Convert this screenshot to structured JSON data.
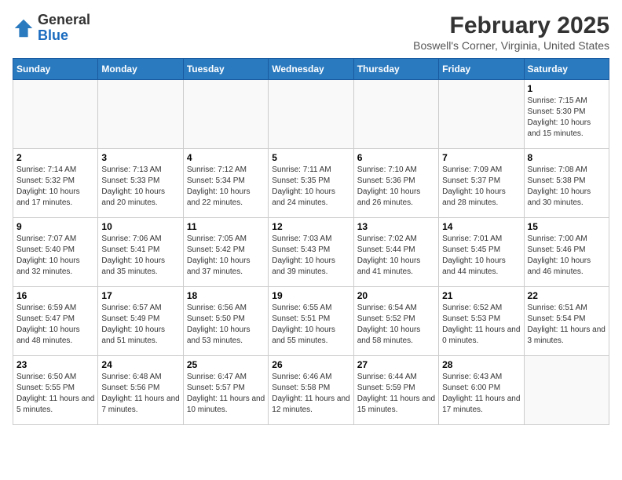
{
  "header": {
    "logo_general": "General",
    "logo_blue": "Blue",
    "month": "February 2025",
    "location": "Boswell's Corner, Virginia, United States"
  },
  "days_of_week": [
    "Sunday",
    "Monday",
    "Tuesday",
    "Wednesday",
    "Thursday",
    "Friday",
    "Saturday"
  ],
  "weeks": [
    [
      {
        "day": "",
        "info": ""
      },
      {
        "day": "",
        "info": ""
      },
      {
        "day": "",
        "info": ""
      },
      {
        "day": "",
        "info": ""
      },
      {
        "day": "",
        "info": ""
      },
      {
        "day": "",
        "info": ""
      },
      {
        "day": "1",
        "info": "Sunrise: 7:15 AM\nSunset: 5:30 PM\nDaylight: 10 hours\nand 15 minutes."
      }
    ],
    [
      {
        "day": "2",
        "info": "Sunrise: 7:14 AM\nSunset: 5:32 PM\nDaylight: 10 hours\nand 17 minutes."
      },
      {
        "day": "3",
        "info": "Sunrise: 7:13 AM\nSunset: 5:33 PM\nDaylight: 10 hours\nand 20 minutes."
      },
      {
        "day": "4",
        "info": "Sunrise: 7:12 AM\nSunset: 5:34 PM\nDaylight: 10 hours\nand 22 minutes."
      },
      {
        "day": "5",
        "info": "Sunrise: 7:11 AM\nSunset: 5:35 PM\nDaylight: 10 hours\nand 24 minutes."
      },
      {
        "day": "6",
        "info": "Sunrise: 7:10 AM\nSunset: 5:36 PM\nDaylight: 10 hours\nand 26 minutes."
      },
      {
        "day": "7",
        "info": "Sunrise: 7:09 AM\nSunset: 5:37 PM\nDaylight: 10 hours\nand 28 minutes."
      },
      {
        "day": "8",
        "info": "Sunrise: 7:08 AM\nSunset: 5:38 PM\nDaylight: 10 hours\nand 30 minutes."
      }
    ],
    [
      {
        "day": "9",
        "info": "Sunrise: 7:07 AM\nSunset: 5:40 PM\nDaylight: 10 hours\nand 32 minutes."
      },
      {
        "day": "10",
        "info": "Sunrise: 7:06 AM\nSunset: 5:41 PM\nDaylight: 10 hours\nand 35 minutes."
      },
      {
        "day": "11",
        "info": "Sunrise: 7:05 AM\nSunset: 5:42 PM\nDaylight: 10 hours\nand 37 minutes."
      },
      {
        "day": "12",
        "info": "Sunrise: 7:03 AM\nSunset: 5:43 PM\nDaylight: 10 hours\nand 39 minutes."
      },
      {
        "day": "13",
        "info": "Sunrise: 7:02 AM\nSunset: 5:44 PM\nDaylight: 10 hours\nand 41 minutes."
      },
      {
        "day": "14",
        "info": "Sunrise: 7:01 AM\nSunset: 5:45 PM\nDaylight: 10 hours\nand 44 minutes."
      },
      {
        "day": "15",
        "info": "Sunrise: 7:00 AM\nSunset: 5:46 PM\nDaylight: 10 hours\nand 46 minutes."
      }
    ],
    [
      {
        "day": "16",
        "info": "Sunrise: 6:59 AM\nSunset: 5:47 PM\nDaylight: 10 hours\nand 48 minutes."
      },
      {
        "day": "17",
        "info": "Sunrise: 6:57 AM\nSunset: 5:49 PM\nDaylight: 10 hours\nand 51 minutes."
      },
      {
        "day": "18",
        "info": "Sunrise: 6:56 AM\nSunset: 5:50 PM\nDaylight: 10 hours\nand 53 minutes."
      },
      {
        "day": "19",
        "info": "Sunrise: 6:55 AM\nSunset: 5:51 PM\nDaylight: 10 hours\nand 55 minutes."
      },
      {
        "day": "20",
        "info": "Sunrise: 6:54 AM\nSunset: 5:52 PM\nDaylight: 10 hours\nand 58 minutes."
      },
      {
        "day": "21",
        "info": "Sunrise: 6:52 AM\nSunset: 5:53 PM\nDaylight: 11 hours\nand 0 minutes."
      },
      {
        "day": "22",
        "info": "Sunrise: 6:51 AM\nSunset: 5:54 PM\nDaylight: 11 hours\nand 3 minutes."
      }
    ],
    [
      {
        "day": "23",
        "info": "Sunrise: 6:50 AM\nSunset: 5:55 PM\nDaylight: 11 hours\nand 5 minutes."
      },
      {
        "day": "24",
        "info": "Sunrise: 6:48 AM\nSunset: 5:56 PM\nDaylight: 11 hours\nand 7 minutes."
      },
      {
        "day": "25",
        "info": "Sunrise: 6:47 AM\nSunset: 5:57 PM\nDaylight: 11 hours\nand 10 minutes."
      },
      {
        "day": "26",
        "info": "Sunrise: 6:46 AM\nSunset: 5:58 PM\nDaylight: 11 hours\nand 12 minutes."
      },
      {
        "day": "27",
        "info": "Sunrise: 6:44 AM\nSunset: 5:59 PM\nDaylight: 11 hours\nand 15 minutes."
      },
      {
        "day": "28",
        "info": "Sunrise: 6:43 AM\nSunset: 6:00 PM\nDaylight: 11 hours\nand 17 minutes."
      },
      {
        "day": "",
        "info": ""
      }
    ]
  ]
}
